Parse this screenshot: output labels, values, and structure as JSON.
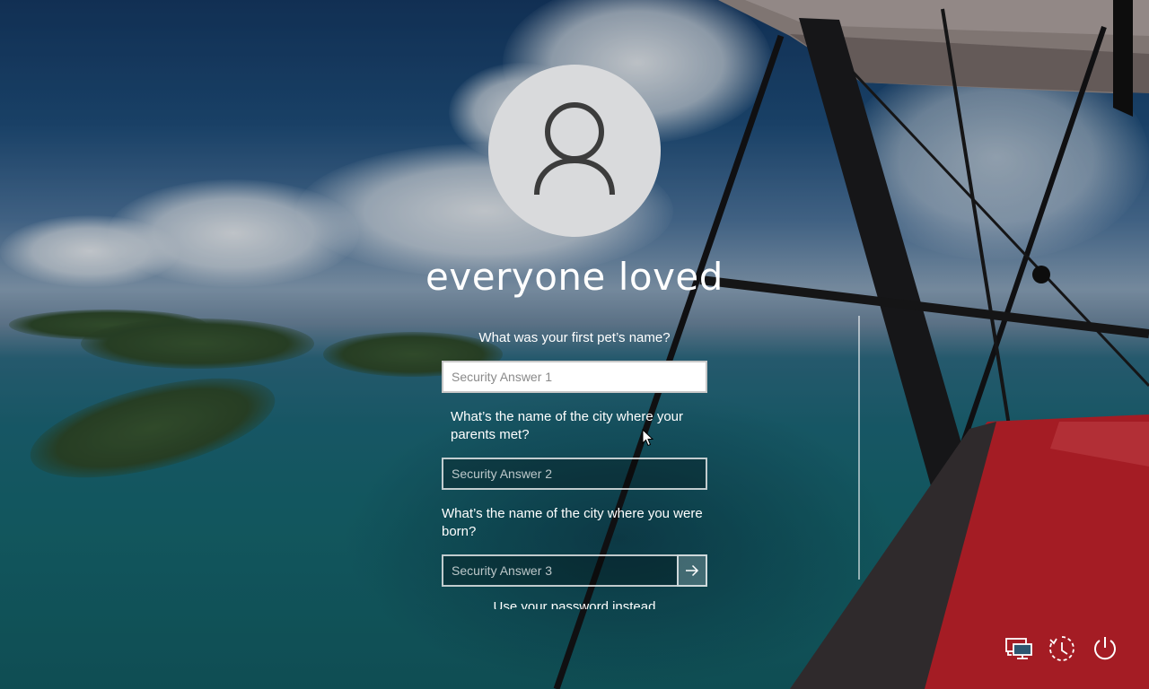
{
  "user": {
    "name": "everyone loved",
    "avatar_icon": "user-silhouette-icon"
  },
  "security_questions": [
    {
      "question": "What was your first pet’s name?",
      "placeholder": "Security Answer 1",
      "value": ""
    },
    {
      "question": "What’s the name of the city where your parents met?",
      "placeholder": "Security Answer 2",
      "value": ""
    },
    {
      "question": "What’s the name of the city where you were born?",
      "placeholder": "Security Answer 3",
      "value": ""
    }
  ],
  "submit_icon": "arrow-right-icon",
  "cutoff_link": "Use your password instead",
  "system_buttons": {
    "network_icon": "network-icon",
    "ease_of_access_icon": "ease-of-access-icon",
    "power_icon": "power-icon"
  },
  "colors": {
    "avatar_bg": "#d9dadc",
    "avatar_glyph": "#3c3c3c",
    "text": "#ffffff",
    "wing_red": "#c8232c"
  }
}
